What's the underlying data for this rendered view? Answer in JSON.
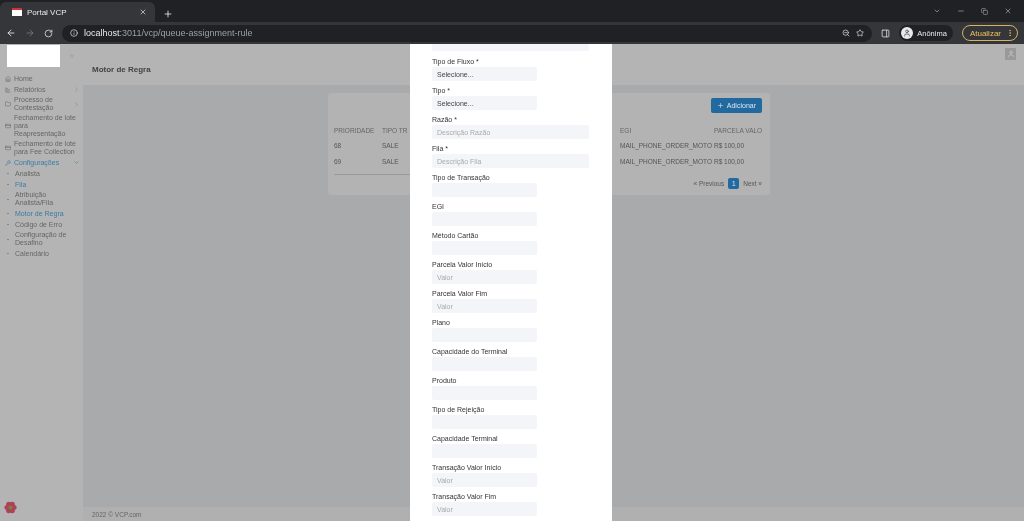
{
  "browser": {
    "tab_title": "Portal VCP",
    "url_host": "localhost",
    "url_path": ":3011/vcp/queue-assignment-rule",
    "profile": "Anônima",
    "update_button": "Atualizar"
  },
  "sidebar": {
    "items": [
      {
        "label": "Home",
        "selected": false
      },
      {
        "label": "Relatórios",
        "expanded": false,
        "selected": false,
        "has_children": true
      },
      {
        "label": "Processo de Contestação",
        "expanded": false,
        "selected": false,
        "has_children": true
      },
      {
        "label": "Fechamento de lote para Reapresentação",
        "selected": false
      },
      {
        "label": "Fechamento de lote para Fee Collection",
        "selected": false
      },
      {
        "label": "Configurações",
        "expanded": true,
        "selected": true,
        "has_children": true,
        "children": [
          {
            "label": "Analista",
            "selected": false
          },
          {
            "label": "Fila",
            "selected": true
          },
          {
            "label": "Atribuição Analista/Fila",
            "selected": false
          },
          {
            "label": "Motor de Regra",
            "selected": true
          },
          {
            "label": "Código de Erro",
            "selected": false
          },
          {
            "label": "Configuração de Desafino",
            "selected": false
          },
          {
            "label": "Calendário",
            "selected": false
          }
        ]
      }
    ]
  },
  "header": {
    "title": "Motor de Regra"
  },
  "card": {
    "add_button": "Adicionar",
    "table": {
      "columns": [
        "PRIORIDADE",
        "TIPO TR",
        "EGI",
        "PARCELA VALO"
      ],
      "rows": [
        [
          "68",
          "SALE",
          "MAIL_PHONE_ORDER_MOTO",
          "R$ 100,00"
        ],
        [
          "69",
          "SALE",
          "MAIL_PHONE_ORDER_MOTO",
          "R$ 100,00"
        ]
      ]
    },
    "pagination": {
      "previous": "« Previous",
      "pages": [
        {
          "label": "1",
          "selected": true
        }
      ],
      "next": "Next »"
    }
  },
  "footer": {
    "text": "2022 © VCP.com"
  },
  "modal": {
    "fields": [
      {
        "label": "Tipo de Fluxo *",
        "kind": "select",
        "value": "Selecione..."
      },
      {
        "label": "Tipo *",
        "kind": "select",
        "value": "Selecione..."
      },
      {
        "label": "Razão *",
        "kind": "wide",
        "placeholder": "Descrição Razão"
      },
      {
        "label": "Fila *",
        "kind": "wide",
        "placeholder": "Descrição Fila"
      },
      {
        "label": "Tipo de Transação",
        "kind": "text"
      },
      {
        "label": "EGI",
        "kind": "text"
      },
      {
        "label": "Método Cartão",
        "kind": "text"
      },
      {
        "label": "Parcela Valor Início",
        "kind": "text",
        "placeholder": "Valor"
      },
      {
        "label": "Parcela Valor Fim",
        "kind": "text",
        "placeholder": "Valor"
      },
      {
        "label": "Plano",
        "kind": "text"
      },
      {
        "label": "Capacidade do Terminal",
        "kind": "text"
      },
      {
        "label": "Produto",
        "kind": "text"
      },
      {
        "label": "Tipo de Rejeição",
        "kind": "text"
      },
      {
        "label": "Capacidade Terminal",
        "kind": "text"
      },
      {
        "label": "Transação Valor Início",
        "kind": "text",
        "placeholder": "Valor"
      },
      {
        "label": "Transação Valor Fim",
        "kind": "text",
        "placeholder": "Valor"
      }
    ]
  }
}
